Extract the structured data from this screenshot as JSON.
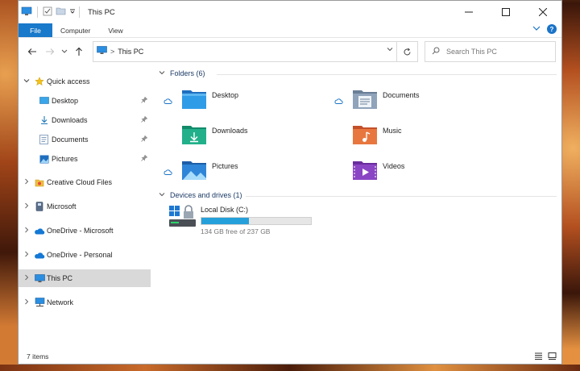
{
  "window": {
    "title": "This PC",
    "controls": {
      "minimize": "—",
      "maximize": "☐",
      "close": "✕"
    }
  },
  "ribbon": {
    "tabs": [
      {
        "label": "File",
        "active": true
      },
      {
        "label": "Computer"
      },
      {
        "label": "View"
      }
    ],
    "help": "?"
  },
  "addressbar": {
    "breadcrumb": [
      "This PC"
    ],
    "separator": ">"
  },
  "search": {
    "placeholder": "Search This PC"
  },
  "sidebar": {
    "items": [
      {
        "label": "Quick access",
        "icon": "star-icon",
        "expanded": true
      },
      {
        "label": "Desktop",
        "icon": "desktop-folder-icon",
        "pinned": true
      },
      {
        "label": "Downloads",
        "icon": "download-icon",
        "pinned": true
      },
      {
        "label": "Documents",
        "icon": "documents-icon",
        "pinned": true
      },
      {
        "label": "Pictures",
        "icon": "pictures-icon",
        "pinned": true
      },
      {
        "label": "Creative Cloud Files",
        "icon": "creative-cloud-icon"
      },
      {
        "label": "Microsoft",
        "icon": "drive-icon"
      },
      {
        "label": "OneDrive - Microsoft",
        "icon": "onedrive-icon"
      },
      {
        "label": "OneDrive - Personal",
        "icon": "onedrive-icon"
      },
      {
        "label": "This PC",
        "icon": "computer-icon",
        "selected": true
      },
      {
        "label": "Network",
        "icon": "network-icon"
      }
    ]
  },
  "main": {
    "folders_header": "Folders (6)",
    "folders": [
      {
        "label": "Desktop",
        "icon": "desktop-folder-icon",
        "cloud": true
      },
      {
        "label": "Documents",
        "icon": "documents-folder-icon",
        "cloud": true
      },
      {
        "label": "Downloads",
        "icon": "downloads-folder-icon",
        "cloud": false
      },
      {
        "label": "Music",
        "icon": "music-folder-icon",
        "cloud": false
      },
      {
        "label": "Pictures",
        "icon": "pictures-folder-icon",
        "cloud": true
      },
      {
        "label": "Videos",
        "icon": "videos-folder-icon",
        "cloud": false
      }
    ],
    "drives_header": "Devices and drives (1)",
    "drives": [
      {
        "label": "Local Disk (C:)",
        "free_text": "134 GB free of 237 GB",
        "used_fraction": 0.435
      }
    ]
  },
  "status": {
    "items": "7 items"
  },
  "colors": {
    "accent": "#1979ca",
    "selection": "#d9d9d9",
    "bar_fill": "#26a0da"
  }
}
